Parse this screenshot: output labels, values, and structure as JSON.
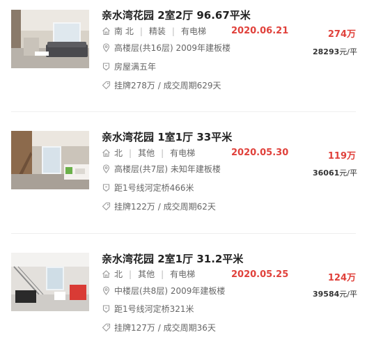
{
  "listings": [
    {
      "title": "亲水湾花园 2室2厅 96.67平米",
      "house_info": [
        "南 北",
        "精装",
        "有电梯"
      ],
      "position_info": "高楼层(共16层) 2009年建板楼",
      "tag": "房屋满五年",
      "deal_cycle": "挂牌278万 / 成交周期629天",
      "deal_date": "2020.06.21",
      "total_price": "274万",
      "unit_price_number": "28293",
      "unit_price_suffix": "元/平"
    },
    {
      "title": "亲水湾花园 1室1厅 33平米",
      "house_info": [
        "北",
        "其他",
        "有电梯"
      ],
      "position_info": "高楼层(共7层) 未知年建板楼",
      "tag": "距1号线河定桥466米",
      "deal_cycle": "挂牌122万 / 成交周期62天",
      "deal_date": "2020.05.30",
      "total_price": "119万",
      "unit_price_number": "36061",
      "unit_price_suffix": "元/平"
    },
    {
      "title": "亲水湾花园 2室1厅 31.2平米",
      "house_info": [
        "北",
        "其他",
        "有电梯"
      ],
      "position_info": "中楼层(共8层) 2009年建板楼",
      "tag": "距1号线河定桥321米",
      "deal_cycle": "挂牌127万 / 成交周期36天",
      "deal_date": "2020.05.25",
      "total_price": "124万",
      "unit_price_number": "39584",
      "unit_price_suffix": "元/平"
    }
  ],
  "icons": {
    "house": "house-icon",
    "position": "location-pin-icon",
    "tag": "shield-badge-icon",
    "cycle": "price-tag-icon"
  },
  "colors": {
    "accent_red": "#e0413b",
    "text_dark": "#222222",
    "text_muted": "#666666",
    "icon_gray": "#999999"
  }
}
